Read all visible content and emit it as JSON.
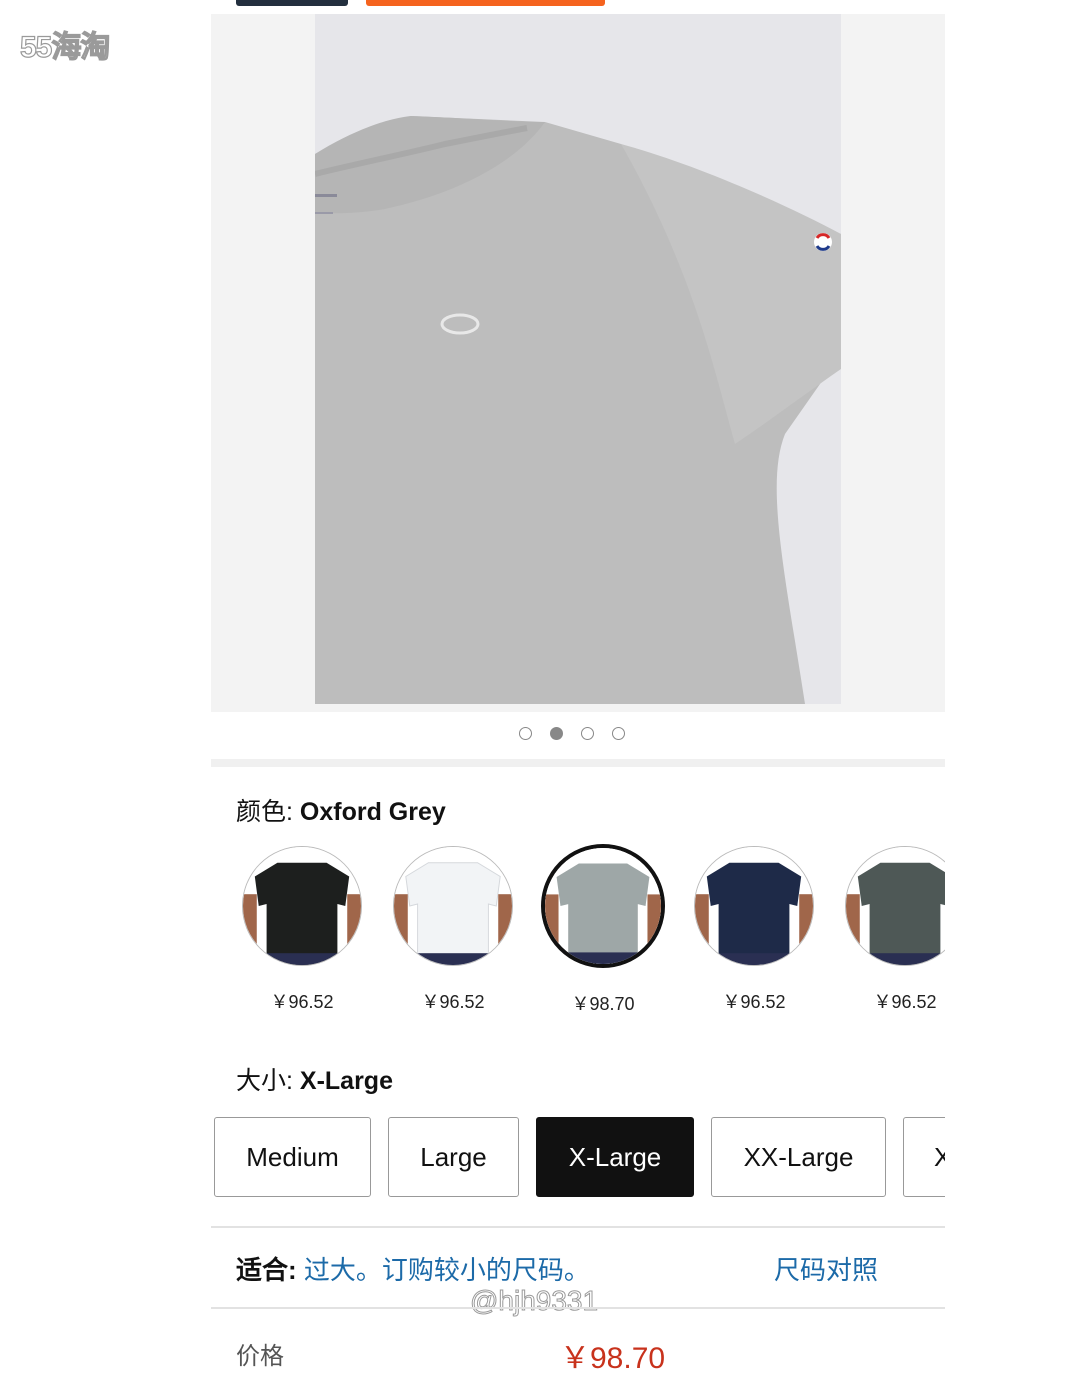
{
  "header": {
    "cut_text": "..."
  },
  "watermark": {
    "site": "55海淘",
    "user": "@hjh9331"
  },
  "gallery": {
    "image": "grey-tshirt-photo",
    "dots": [
      false,
      true,
      false,
      false
    ]
  },
  "color": {
    "label": "颜色: ",
    "selected": "Oxford Grey",
    "options": [
      {
        "name": "black",
        "price": "￥96.52",
        "color": "#1d1f1e",
        "selected": false
      },
      {
        "name": "white",
        "price": "￥96.52",
        "color": "#f2f4f6",
        "selected": false
      },
      {
        "name": "oxford-grey",
        "price": "￥98.70",
        "color": "#9ea7a7",
        "selected": true
      },
      {
        "name": "navy",
        "price": "￥96.52",
        "color": "#1e2a48",
        "selected": false
      },
      {
        "name": "granite-heather",
        "price": "￥96.52",
        "color": "#4e5856",
        "selected": false
      }
    ]
  },
  "size": {
    "label": "大小: ",
    "selected": "X-Large",
    "options": [
      "Medium",
      "Large",
      "X-Large",
      "XX-Large",
      "X"
    ]
  },
  "fit": {
    "label": "适合: ",
    "value": "过大。订购较小的尺码。",
    "size_chart": "尺码对照"
  },
  "price": {
    "label": "价格",
    "value": "￥98.70"
  }
}
